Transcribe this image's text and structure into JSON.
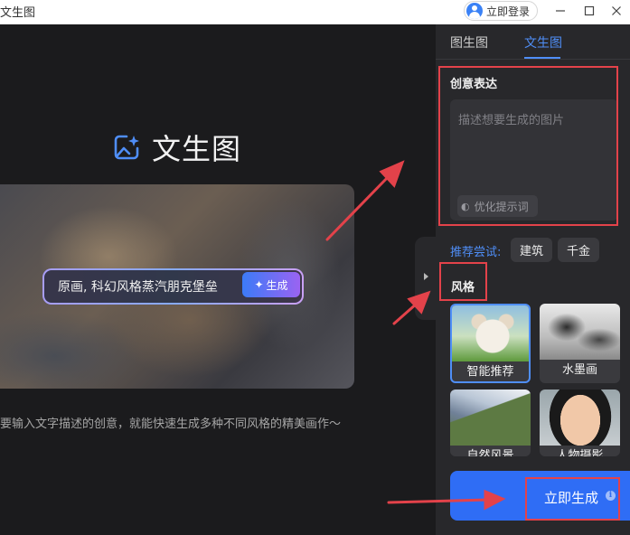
{
  "titlebar": {
    "app_title": "文生图",
    "login_label": "立即登录"
  },
  "main": {
    "title": "文生图",
    "prompt_text": "原画, 科幻风格蒸汽朋克堡垒",
    "generate_label": "生成",
    "description": "要输入文字描述的创意，就能快速生成多种不同风格的精美画作～"
  },
  "panel": {
    "tabs": [
      {
        "label": "图生图",
        "active": false
      },
      {
        "label": "文生图",
        "active": true
      }
    ],
    "creative_label": "创意表达",
    "prompt_placeholder": "描述想要生成的图片",
    "optimize_label": "优化提示词",
    "try_label": "推荐尝试:",
    "suggestions": [
      "建筑",
      "千金"
    ],
    "style_label": "风格",
    "styles": [
      {
        "label": "智能推荐",
        "selected": true
      },
      {
        "label": "水墨画",
        "selected": false
      },
      {
        "label": "自然风景",
        "selected": false
      },
      {
        "label": "人物摄影",
        "selected": false
      }
    ],
    "generate_now_label": "立即生成"
  },
  "colors": {
    "accent": "#4f8ef7",
    "highlight": "#e3424a",
    "primary_button": "#2f6df5"
  }
}
